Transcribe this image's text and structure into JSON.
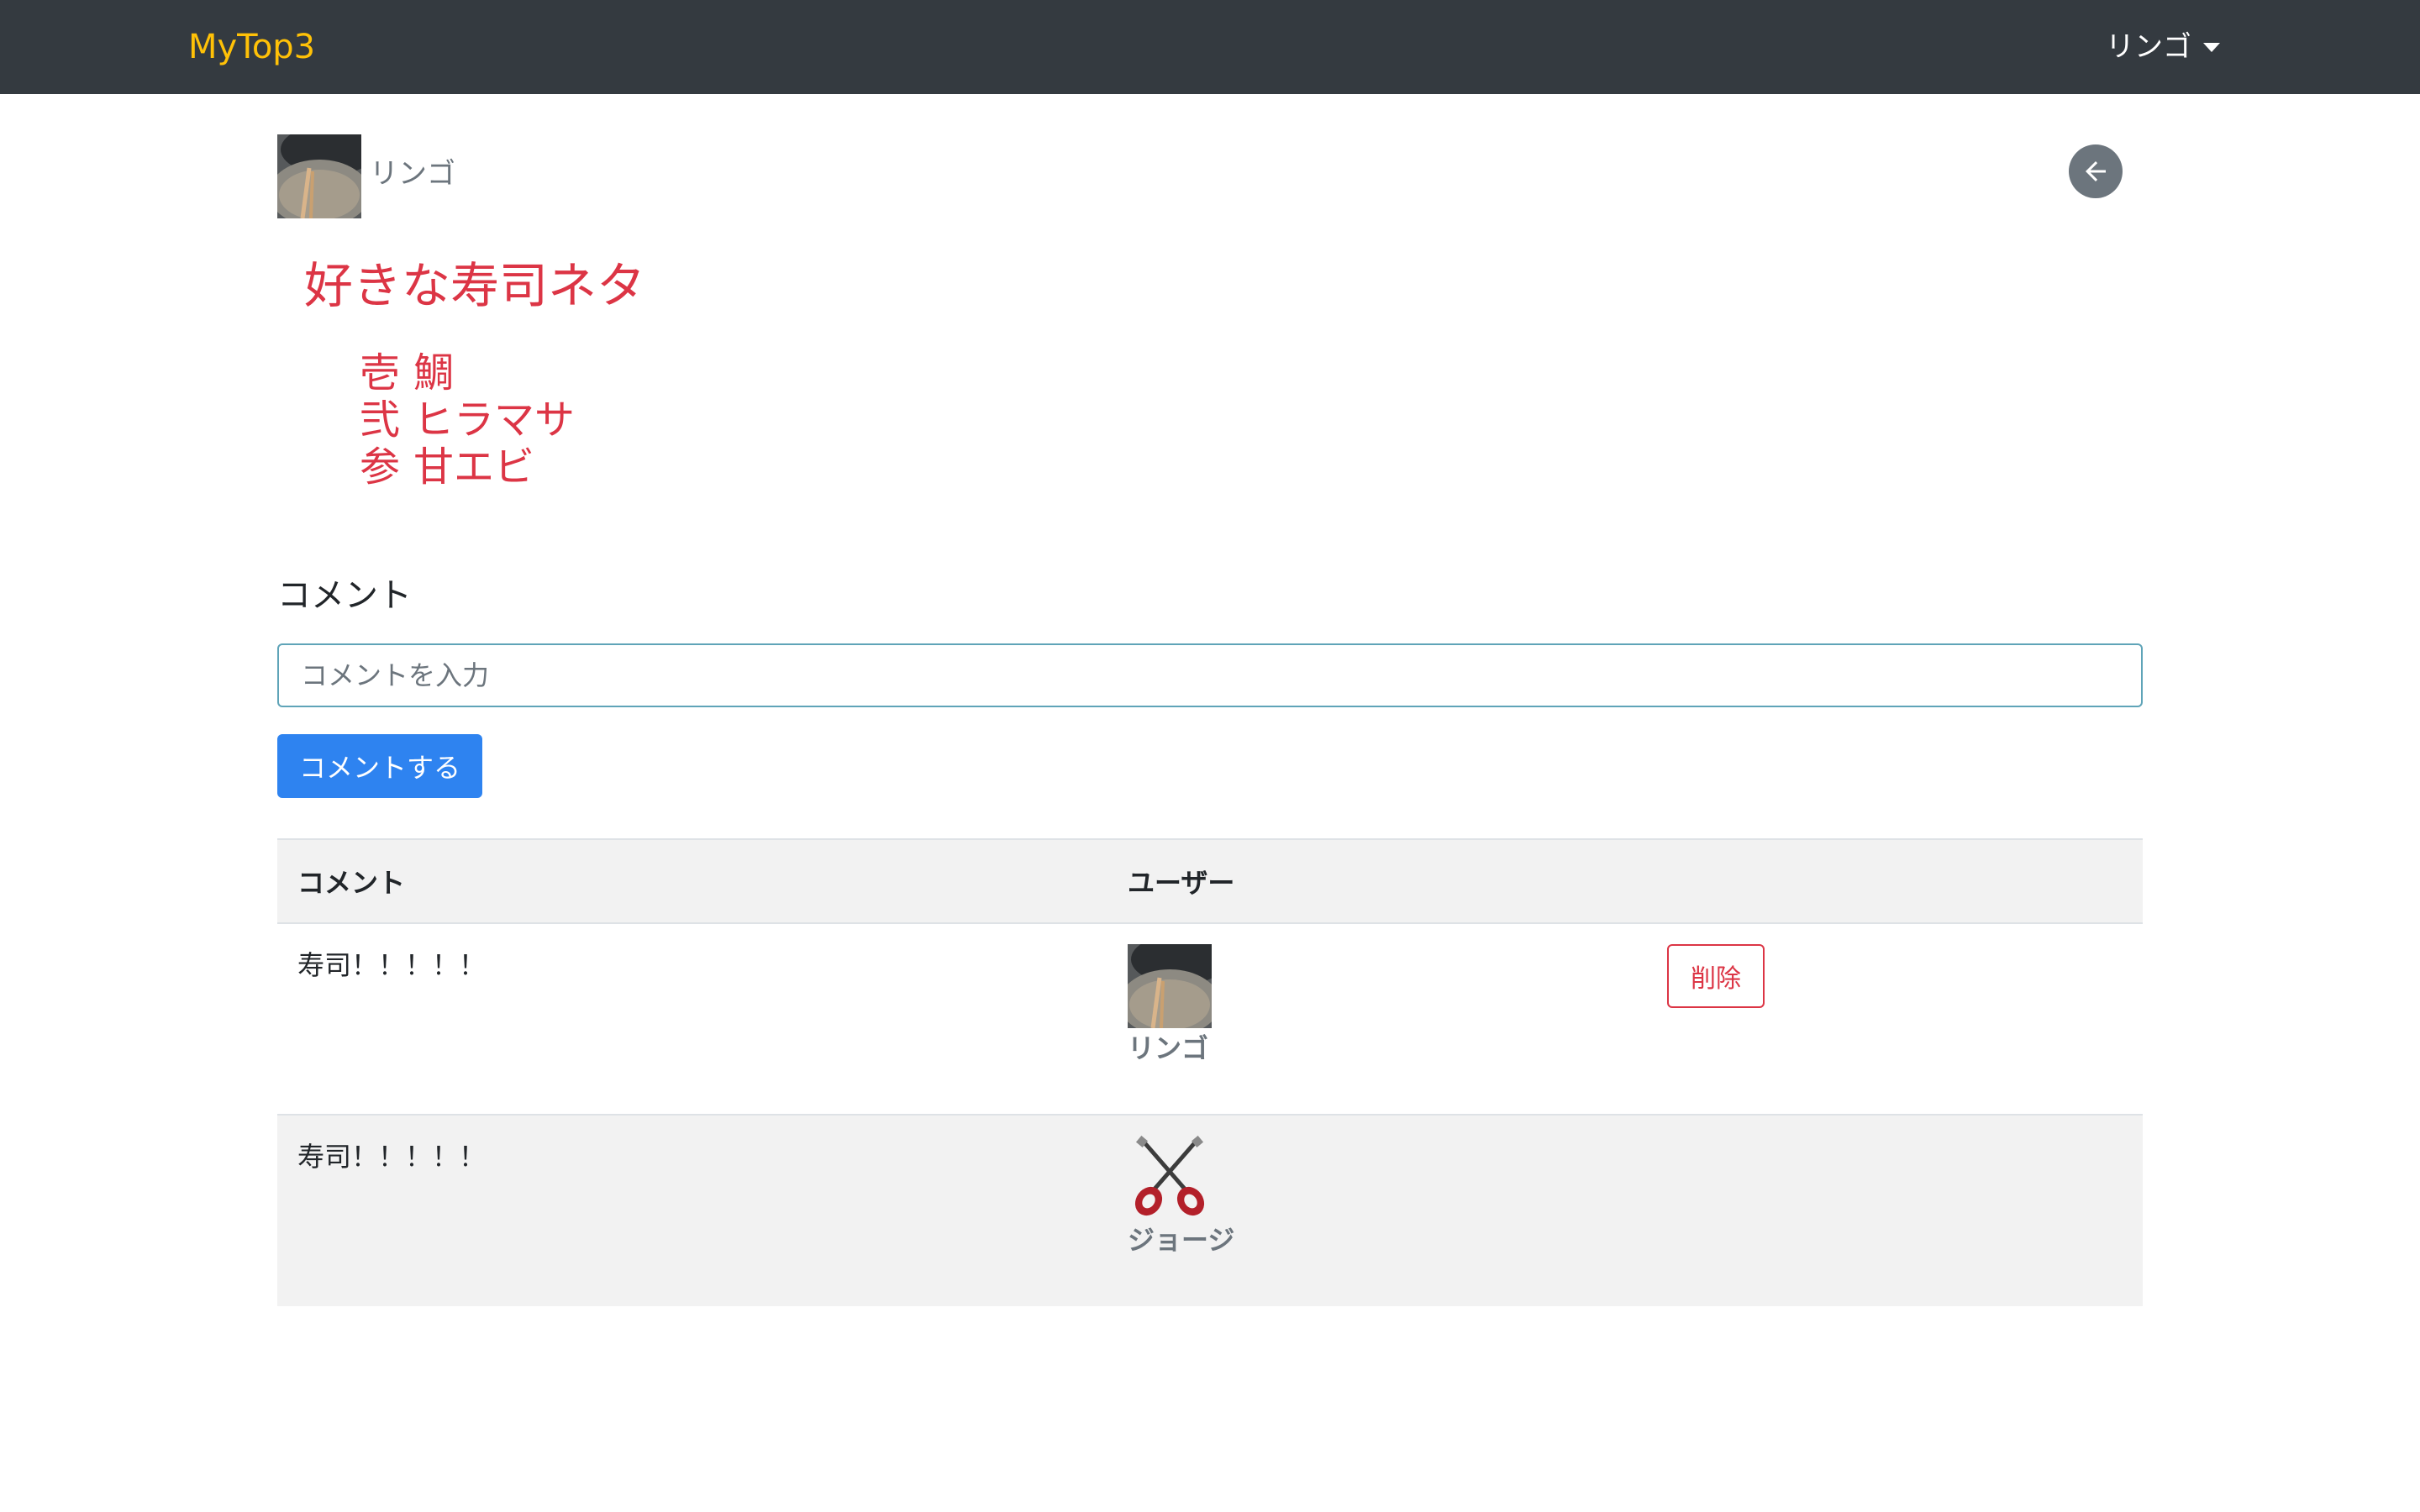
{
  "navbar": {
    "brand": "MyTop3",
    "user_menu_label": "リンゴ",
    "brand_color": "#ffc107",
    "background_color": "#343a40"
  },
  "owner": {
    "name": "リンゴ",
    "avatar_icon": "drum-photo-icon"
  },
  "back_button": {
    "icon": "arrow-left-icon"
  },
  "topic": {
    "title": "好きな寿司ネタ",
    "ranks": [
      {
        "rank": "壱",
        "item": "鯛"
      },
      {
        "rank": "弐",
        "item": "ヒラマサ"
      },
      {
        "rank": "参",
        "item": "甘エビ"
      }
    ],
    "color": "#dc3545"
  },
  "comment_form": {
    "heading": "コメント",
    "placeholder": "コメントを入力",
    "submit_label": "コメントする",
    "submit_color": "#2e83f0"
  },
  "comment_table": {
    "headers": [
      "コメント",
      "ユーザー",
      ""
    ],
    "rows": [
      {
        "comment": "寿司！！！！！",
        "user": "リンゴ",
        "avatar_icon": "drum-photo-icon",
        "delete_label": "削除"
      },
      {
        "comment": "寿司！！！！！",
        "user": "ジョージ",
        "avatar_icon": "crossed-guitars-icon"
      }
    ]
  }
}
